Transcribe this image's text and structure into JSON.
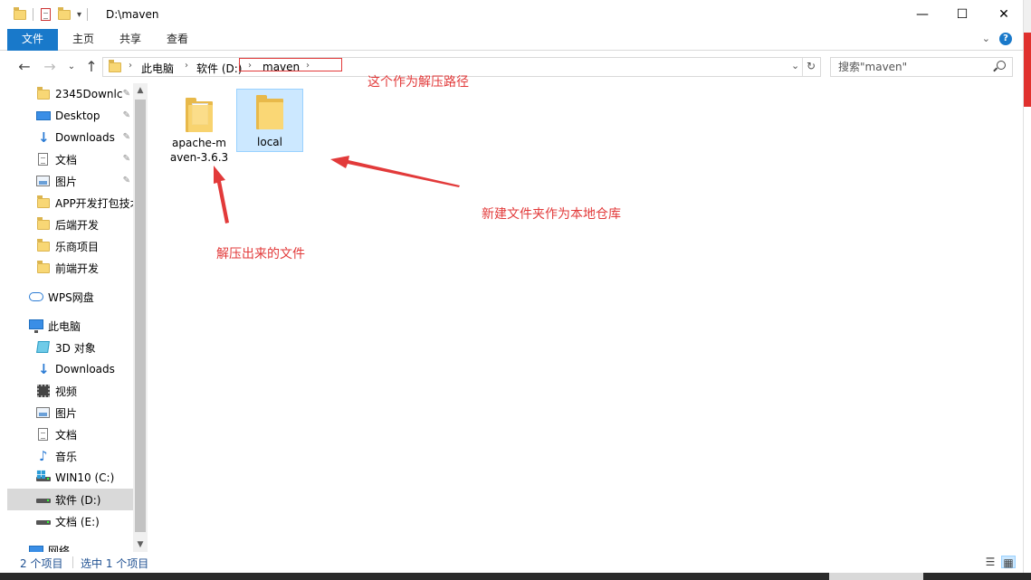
{
  "window": {
    "title": "D:\\maven",
    "minimize_glyph": "—",
    "maximize_glyph": "☐",
    "close_glyph": "✕"
  },
  "ribbon": {
    "tabs": [
      "文件",
      "主页",
      "共享",
      "查看"
    ],
    "active_tab": "文件",
    "expand_glyph": "⌄"
  },
  "address": {
    "back_glyph": "←",
    "forward_glyph": "→",
    "recent_glyph": "⌄",
    "up_glyph": "↑",
    "crumbs": [
      "此电脑",
      "软件 (D:)",
      "maven"
    ],
    "dropdown_glyph": "⌄",
    "refresh_glyph": "↻"
  },
  "search": {
    "placeholder": "搜索\"maven\"",
    "icon": "search-icon"
  },
  "nav": {
    "quick_access": [
      {
        "label": "2345Downlc",
        "icon": "folder-icon",
        "pinned": true
      },
      {
        "label": "Desktop",
        "icon": "desktop-icon",
        "pinned": true
      },
      {
        "label": "Downloads",
        "icon": "download-icon",
        "pinned": true
      },
      {
        "label": "文档",
        "icon": "document-icon",
        "pinned": true
      },
      {
        "label": "图片",
        "icon": "picture-icon",
        "pinned": true
      },
      {
        "label": "APP开发打包技术",
        "icon": "folder-icon",
        "pinned": false
      },
      {
        "label": "后端开发",
        "icon": "folder-icon",
        "pinned": false
      },
      {
        "label": "乐商项目",
        "icon": "folder-icon",
        "pinned": false
      },
      {
        "label": "前端开发",
        "icon": "folder-icon",
        "pinned": false
      }
    ],
    "wps": {
      "label": "WPS网盘",
      "icon": "cloud-icon"
    },
    "this_pc": {
      "label": "此电脑",
      "icon": "computer-icon"
    },
    "pc_items": [
      {
        "label": "3D 对象",
        "icon": "3d-objects-icon"
      },
      {
        "label": "Downloads",
        "icon": "download-icon"
      },
      {
        "label": "视频",
        "icon": "video-icon"
      },
      {
        "label": "图片",
        "icon": "picture-icon"
      },
      {
        "label": "文档",
        "icon": "document-icon"
      },
      {
        "label": "音乐",
        "icon": "music-icon"
      },
      {
        "label": "WIN10 (C:)",
        "icon": "windows-drive-icon"
      },
      {
        "label": "软件 (D:)",
        "icon": "drive-icon",
        "selected": true
      },
      {
        "label": "文档 (E:)",
        "icon": "drive-icon"
      }
    ],
    "network": {
      "label": "网络",
      "icon": "network-icon"
    },
    "pin_glyph": "📌",
    "expand_glyph": "›"
  },
  "files": [
    {
      "name": "apache-maven-3.6.3",
      "line1": "apache-m",
      "line2": "aven-3.6.3",
      "type": "folder",
      "selected": false
    },
    {
      "name": "local",
      "line1": "local",
      "line2": "",
      "type": "folder",
      "selected": true
    }
  ],
  "annotations": {
    "path_note": "这个作为解压路径",
    "extracted_note": "解压出来的文件",
    "new_folder_note": "新建文件夹作为本地仓库"
  },
  "status": {
    "item_count": "2 个项目",
    "selection": "选中 1 个项目"
  },
  "colors": {
    "accent": "#1979ca",
    "annotation": "#e23a3a",
    "selection": "#cce8ff",
    "folder": "#fad775"
  }
}
